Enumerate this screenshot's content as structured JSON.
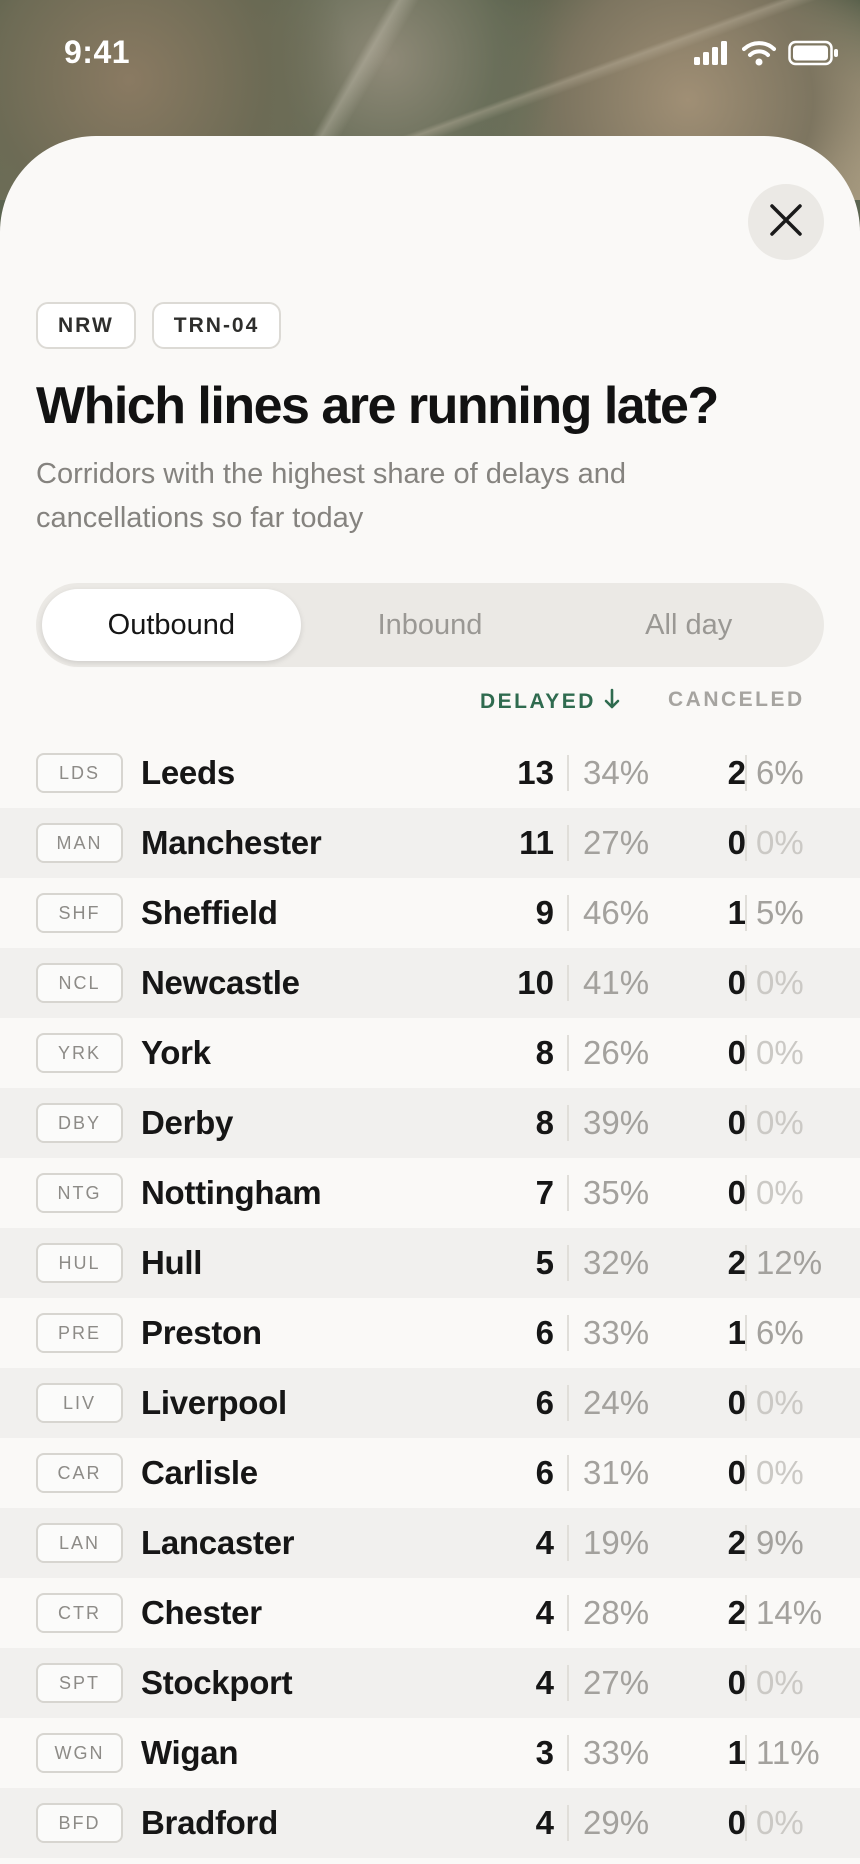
{
  "status": {
    "time": "9:41"
  },
  "tags": [
    "NRW",
    "TRN-04"
  ],
  "title": "Which lines are running late?",
  "subtitle": "Corridors with the highest share of delays and cancellations so far today",
  "tabs": [
    {
      "label": "Outbound",
      "active": true
    },
    {
      "label": "Inbound",
      "active": false
    },
    {
      "label": "All day",
      "active": false
    }
  ],
  "columns": {
    "delayed": "DELAYED",
    "canceled": "CANCELED",
    "sort": "delayed-desc"
  },
  "rows": [
    {
      "code": "LDS",
      "name": "Leeds",
      "delayed": "13",
      "delayed_pct": "34%",
      "canceled": "2",
      "canceled_pct": "6%"
    },
    {
      "code": "MAN",
      "name": "Manchester",
      "delayed": "11",
      "delayed_pct": "27%",
      "canceled": "0",
      "canceled_pct": "0%"
    },
    {
      "code": "SHF",
      "name": "Sheffield",
      "delayed": "9",
      "delayed_pct": "46%",
      "canceled": "1",
      "canceled_pct": "5%"
    },
    {
      "code": "NCL",
      "name": "Newcastle",
      "delayed": "10",
      "delayed_pct": "41%",
      "canceled": "0",
      "canceled_pct": "0%"
    },
    {
      "code": "YRK",
      "name": "York",
      "delayed": "8",
      "delayed_pct": "26%",
      "canceled": "0",
      "canceled_pct": "0%"
    },
    {
      "code": "DBY",
      "name": "Derby",
      "delayed": "8",
      "delayed_pct": "39%",
      "canceled": "0",
      "canceled_pct": "0%"
    },
    {
      "code": "NTG",
      "name": "Nottingham",
      "delayed": "7",
      "delayed_pct": "35%",
      "canceled": "0",
      "canceled_pct": "0%"
    },
    {
      "code": "HUL",
      "name": "Hull",
      "delayed": "5",
      "delayed_pct": "32%",
      "canceled": "2",
      "canceled_pct": "12%"
    },
    {
      "code": "PRE",
      "name": "Preston",
      "delayed": "6",
      "delayed_pct": "33%",
      "canceled": "1",
      "canceled_pct": "6%"
    },
    {
      "code": "LIV",
      "name": "Liverpool",
      "delayed": "6",
      "delayed_pct": "24%",
      "canceled": "0",
      "canceled_pct": "0%"
    },
    {
      "code": "CAR",
      "name": "Carlisle",
      "delayed": "6",
      "delayed_pct": "31%",
      "canceled": "0",
      "canceled_pct": "0%"
    },
    {
      "code": "LAN",
      "name": "Lancaster",
      "delayed": "4",
      "delayed_pct": "19%",
      "canceled": "2",
      "canceled_pct": "9%"
    },
    {
      "code": "CTR",
      "name": "Chester",
      "delayed": "4",
      "delayed_pct": "28%",
      "canceled": "2",
      "canceled_pct": "14%"
    },
    {
      "code": "SPT",
      "name": "Stockport",
      "delayed": "4",
      "delayed_pct": "27%",
      "canceled": "0",
      "canceled_pct": "0%"
    },
    {
      "code": "WGN",
      "name": "Wigan",
      "delayed": "3",
      "delayed_pct": "33%",
      "canceled": "1",
      "canceled_pct": "11%"
    },
    {
      "code": "BFD",
      "name": "Bradford",
      "delayed": "4",
      "delayed_pct": "29%",
      "canceled": "0",
      "canceled_pct": "0%"
    }
  ],
  "icons": {
    "close": "close-icon",
    "sort": "arrow-down-icon",
    "signal": "cellular-signal-icon",
    "wifi": "wifi-icon",
    "battery": "battery-icon"
  },
  "colors": {
    "accent": "#2f6b4f",
    "sheet": "#faf9f7",
    "zebra": "#f1f0ee"
  }
}
